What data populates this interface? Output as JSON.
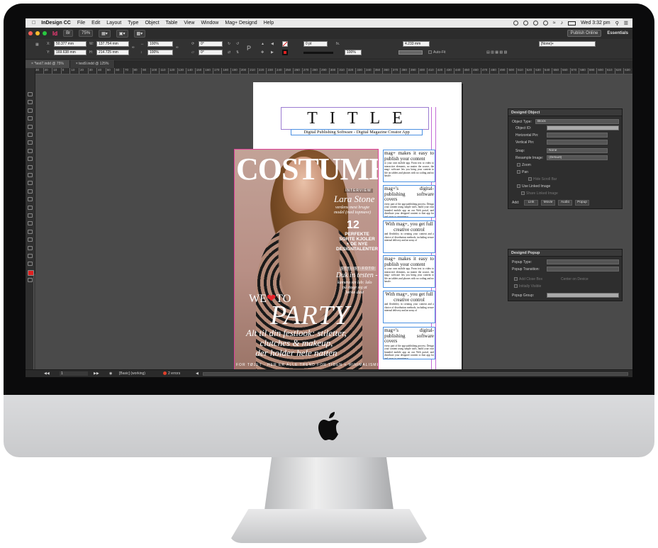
{
  "menubar": {
    "app": "InDesign CC",
    "items": [
      "File",
      "Edit",
      "Layout",
      "Type",
      "Object",
      "Table",
      "View",
      "Window",
      "Mag+ Designd",
      "Help"
    ],
    "clock": "Wed 3:32 pm"
  },
  "appbar": {
    "logo": "Id",
    "zoom": "75%",
    "publish": "Publish Online",
    "workspace": "Essentials"
  },
  "control": {
    "x_label": "X:",
    "x": "50.377 mm",
    "y_label": "Y:",
    "y": "169.638 mm",
    "w_label": "W:",
    "w": "137.754 mm",
    "h_label": "H:",
    "h": "214.725 mm",
    "scale_x": "100%",
    "scale_y": "100%",
    "angle1": "0°",
    "angle2": "0°",
    "stroke": "0 pt",
    "size": "4.233 mm",
    "percent": "100%",
    "autofit": "Auto-Fit",
    "style": "[None]+"
  },
  "tabs": [
    {
      "label": "*test7.indd @ 75%"
    },
    {
      "label": "test9.indd @ 125%"
    }
  ],
  "ruler": {
    "ticks": [
      "30",
      "20",
      "10",
      "0",
      "10",
      "20",
      "30",
      "40",
      "50",
      "60",
      "70",
      "80",
      "90",
      "100",
      "110",
      "120",
      "130",
      "140",
      "150",
      "160",
      "170",
      "180",
      "190",
      "200",
      "210",
      "220",
      "230",
      "240",
      "250",
      "260",
      "270",
      "280",
      "290",
      "300",
      "310",
      "320",
      "330",
      "340",
      "350",
      "360",
      "370",
      "380",
      "390",
      "400",
      "410",
      "420",
      "430",
      "440",
      "450",
      "460",
      "470",
      "480",
      "490",
      "500",
      "510",
      "520",
      "530",
      "540",
      "550",
      "560",
      "570",
      "580",
      "590",
      "600",
      "610",
      "620",
      "630"
    ]
  },
  "document": {
    "title": "TITLE",
    "subtitle": "Digital Publishing Software - Digital Magazine Creator App",
    "cover": {
      "masthead": "COSTUME",
      "interview": "INTERVIEW",
      "name": "Lara Stone",
      "tagline": "verdens mest brugte\nmodel (med topmave)",
      "number": "12",
      "perfekte": "PERFEKTE\nSORTE KJOLER\n+ DE NYE\nDESIGNTALENTER",
      "stylist": "STYLIST-FOTO",
      "duk": "Duk in testen -",
      "kamera": "kamera sin lab: lalo\npå stage sig at\nførste date",
      "we_to": "WE",
      "to_word": "TO",
      "party": "PARTY",
      "alt": "Alt til din festlook: stiletter,\nclutches & makeup,\nder holder hele natten",
      "bottom": "FOR TØJET - HER ER ALLE TREND FOR TIDEN + MINIMALISME PÅ RETTEN"
    },
    "columns": [
      {
        "heading": "mag+ makes it easy to publish your content",
        "body": "to your own mobile app. From text to video to interactive elements, no matter the source, the mag+ software lets you bring your content to life on tablets and phones with no coding and no hassle."
      },
      {
        "heading": "mag+'s digital-publishing software covers",
        "body": "every part of the app-publishing process. Design your content using simple tools, build your own branded mobile app on our Web portal, and distribute your designed content to that app for end users to experience."
      },
      {
        "heading": "With mag+, you get full creative control",
        "body": "and flexibility in creating your content and a choice of distribution methods, including secure internal delivery and an array of"
      },
      {
        "heading": "mag+ makes it easy to publish your content",
        "body": "to your own mobile app. From text to video to interactive elements, no matter the source, the mag+ software lets you bring your content to life on tablets and phones with no coding and no hassle."
      },
      {
        "heading": "With mag+, you get full creative control",
        "body": "and flexibility in creating your content and a choice of distribution methods, including secure internal delivery and an array of"
      },
      {
        "heading": "mag+'s digital-publishing software covers",
        "body": "every part of the app-publishing process. Design your content using simple tools, build your own branded mobile app on our Web portal, and distribute your designed content to that app for end users to experience."
      }
    ]
  },
  "designd_object": {
    "title": "Designd Object",
    "object_type_label": "Object Type:",
    "object_type": "Block",
    "object_id_label": "Object ID:",
    "hpin_label": "Horizontal Pin:",
    "vpin_label": "Vertical Pin:",
    "snap_label": "Snap:",
    "snap": "None",
    "resample_label": "Resample Image:",
    "resample": "(Default)",
    "zoom": "Zoom",
    "pan": "Pan",
    "hide_scroll": "Hide Scroll Bar",
    "use_linked": "Use Linked Image",
    "share_linked": "Share Linked Image",
    "add_label": "Add:",
    "buttons": [
      "Link",
      "Movie",
      "Audio",
      "Popup"
    ]
  },
  "designd_popup": {
    "title": "Designd Popup",
    "type_label": "Popup Type:",
    "transition_label": "Popup Transition:",
    "add_close": "Add Close Box",
    "center": "Center on Device",
    "visible": "Initially Visible",
    "group_label": "Popup Group:"
  },
  "status": {
    "page": "1",
    "style": "[Basic] (working)",
    "errors": "2 errors"
  }
}
